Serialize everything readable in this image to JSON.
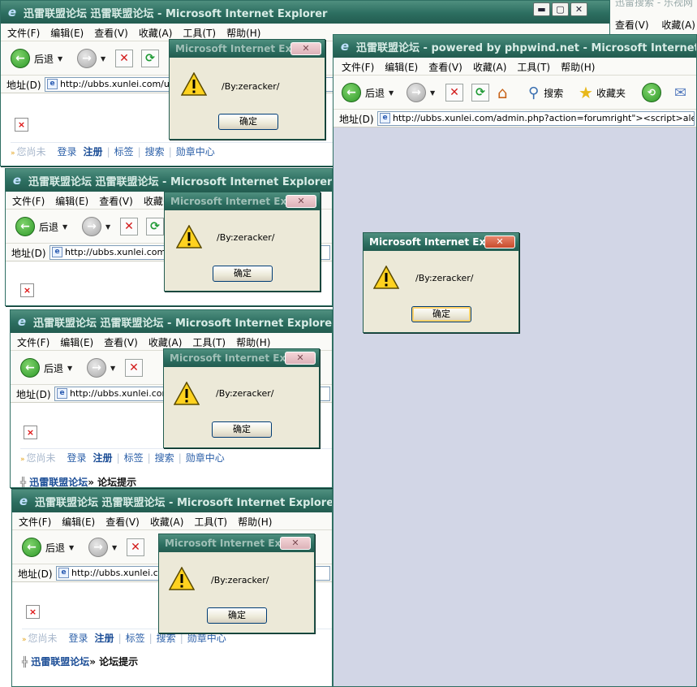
{
  "menu": [
    "文件(F)",
    "编辑(E)",
    "查看(V)",
    "收藏(A)",
    "工具(T)",
    "帮助(H)"
  ],
  "toolbar": {
    "back": "后退",
    "search": "搜索",
    "favorites": "收藏夹"
  },
  "address_label": "地址(D)",
  "nav": {
    "muted": "您尚未",
    "login": "登录",
    "register": "注册",
    "tags": "标签",
    "search": "搜索",
    "medals": "勋章中心"
  },
  "crumb": {
    "site": "迅雷联盟论坛",
    "page": "» 论坛提示"
  },
  "dialog": {
    "title": "Microsoft Internet Expl...",
    "message": "/By:zeracker/",
    "ok": "确定"
  },
  "windows": [
    {
      "title": "迅雷联盟论坛 迅雷联盟论坛 - Microsoft Internet Explorer",
      "address": "http://ubbs.xunlei.com/use"
    },
    {
      "title": "迅雷联盟论坛 迅雷联盟论坛 - Microsoft Internet Explorer",
      "address": "http://ubbs.xunlei.com/h"
    },
    {
      "title": "迅雷联盟论坛 迅雷联盟论坛 - Microsoft Internet Explorer",
      "address": "http://ubbs.xunlei.com/"
    },
    {
      "title": "迅雷联盟论坛 迅雷联盟论坛 - Microsoft Internet Explorer",
      "address": "http://ubbs.xunlei.com"
    },
    {
      "title": "迅雷联盟论坛 - powered by phpwind.net - Microsoft Internet Explorer",
      "address": "http://ubbs.xunlei.com/admin.php?action=forumright\"><script>alert(/By:zera"
    }
  ],
  "bg_window_title_fragment": "迅雷搜索 - 乐视网"
}
